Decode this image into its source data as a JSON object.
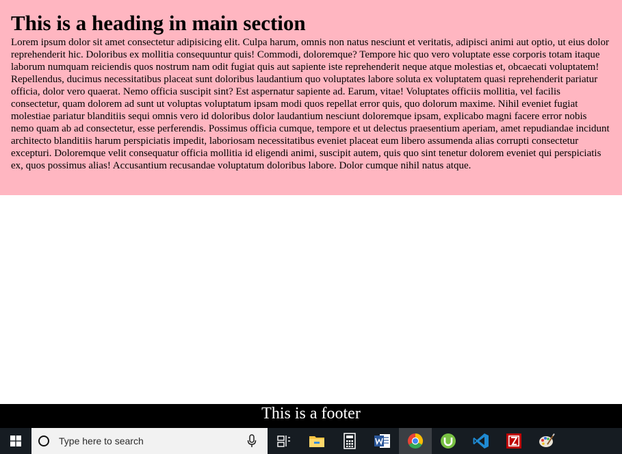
{
  "main": {
    "heading": "This is a heading in main section",
    "paragraph": "Lorem ipsum dolor sit amet consectetur adipisicing elit. Culpa harum, omnis non natus nesciunt et veritatis, adipisci animi aut optio, ut eius dolor reprehenderit hic. Doloribus ex mollitia consequuntur quis! Commodi, doloremque? Tempore hic quo vero voluptate esse corporis totam itaque laborum numquam reiciendis quos nostrum nam odit fugiat quis aut sapiente iste reprehenderit neque atque molestias et, obcaecati voluptatem! Repellendus, ducimus necessitatibus placeat sunt doloribus laudantium quo voluptates labore soluta ex voluptatem quasi reprehenderit pariatur officia, dolor vero quaerat. Nemo officia suscipit sint? Est aspernatur sapiente ad. Earum, vitae! Voluptates officiis mollitia, vel facilis consectetur, quam dolorem ad sunt ut voluptas voluptatum ipsam modi quos repellat error quis, quo dolorum maxime. Nihil eveniet fugiat molestiae pariatur blanditiis sequi omnis vero id doloribus dolor laudantium nesciunt doloremque ipsam, explicabo magni facere error nobis nemo quam ab ad consectetur, esse perferendis. Possimus officia cumque, tempore et ut delectus praesentium aperiam, amet repudiandae incidunt architecto blanditiis harum perspiciatis impedit, laboriosam necessitatibus eveniet placeat eum libero assumenda alias corrupti consectetur excepturi. Doloremque velit consequatur officia mollitia id eligendi animi, suscipit autem, quis quo sint tenetur dolorem eveniet qui perspiciatis ex, quos possimus alias! Accusantium recusandae voluptatum doloribus labore. Dolor cumque nihil natus atque."
  },
  "footer": {
    "text": "This is a footer"
  },
  "taskbar": {
    "search_placeholder": "Type here to search",
    "icons": [
      "windows-start-icon",
      "cortana-icon",
      "microphone-icon",
      "task-view-icon",
      "file-explorer-icon",
      "calculator-icon",
      "word-icon",
      "chrome-icon",
      "utorrent-icon",
      "vscode-icon",
      "filezilla-icon",
      "paint-icon"
    ]
  },
  "colors": {
    "main_background": "#ffb6c1",
    "footer_background": "#000000",
    "taskbar_background": "#161c22"
  }
}
